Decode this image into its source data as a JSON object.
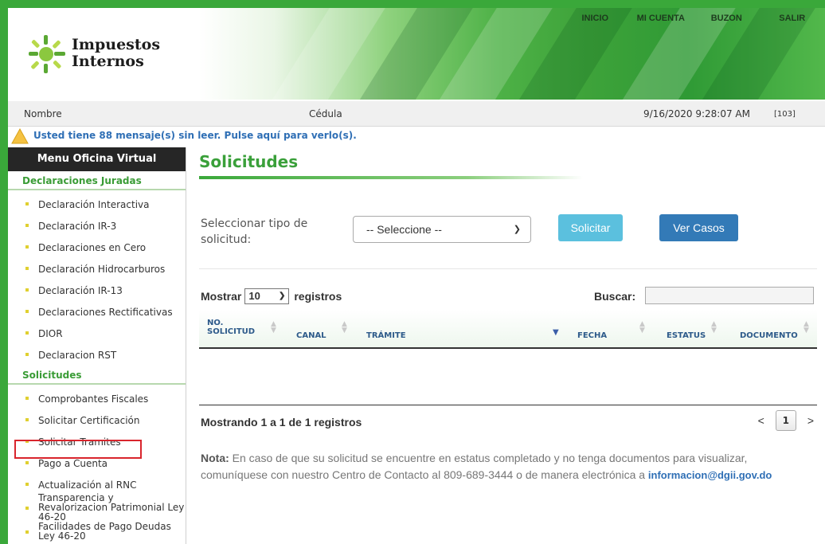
{
  "header": {
    "logo_line1": "Impuestos",
    "logo_line2": "Internos",
    "nav": [
      "INICIO",
      "MI CUENTA",
      "BUZON",
      "SALIR"
    ]
  },
  "infobar": {
    "name_label": "Nombre",
    "cedula_label": "Cédula",
    "datetime": "9/16/2020 9:28:07 AM",
    "code": "[103]"
  },
  "messages": {
    "text": "Usted tiene 88 mensaje(s) sin leer. Pulse aquí para verlo(s)."
  },
  "sidebar": {
    "title": "Menu Oficina Virtual",
    "section1_title": "Declaraciones Juradas",
    "section1_items": [
      "Declaración Interactiva",
      "Declaración IR-3",
      "Declaraciones en Cero",
      "Declaración Hidrocarburos",
      "Declaración IR-13",
      "Declaraciones Rectificativas",
      "DIOR",
      "Declaracion RST"
    ],
    "section2_title": "Solicitudes",
    "section2_items": [
      "Comprobantes Fiscales",
      "Solicitar Certificación",
      "Solicitar Tramites",
      "Pago a Cuenta",
      "Actualización al RNC",
      "Transparencia y Revalorizacion Patrimonial Ley 46-20",
      "Facilidades de Pago Deudas Ley 46-20"
    ]
  },
  "main": {
    "title": "Solicitudes",
    "form_label": "Seleccionar tipo de solicitud:",
    "select_value": "-- Seleccione --",
    "solicitar_button": "Solicitar",
    "ver_casos_button": "Ver Casos",
    "mostrar_label": "Mostrar",
    "page_length": "10",
    "registros_label": "registros",
    "buscar_label": "Buscar:",
    "search_value": "",
    "columns": {
      "no_solicitud_1": "NO.",
      "no_solicitud_2": "SOLICITUD",
      "canal": "CANAL",
      "tramite": "TRÁMITE",
      "fecha": "FECHA",
      "estatus": "ESTATUS",
      "documento": "DOCUMENTO"
    },
    "info": "Mostrando 1 a 1 de 1 registros",
    "pager_prev": "<",
    "pager_page": "1",
    "pager_next": ">",
    "nota_label": "Nota:",
    "nota_text": " En caso de que su solicitud se encuentre en estatus completado y no tenga documentos para visualizar, comuníquese con nuestro Centro de Contacto al 809-689-3444 o de manera electrónica a ",
    "email": "informacion@dgii.gov.do"
  },
  "colors": {
    "brand_green": "#3aa83a",
    "primary_blue": "#337ab7",
    "info_blue": "#5bc0de",
    "highlight_red": "#d9252d"
  }
}
